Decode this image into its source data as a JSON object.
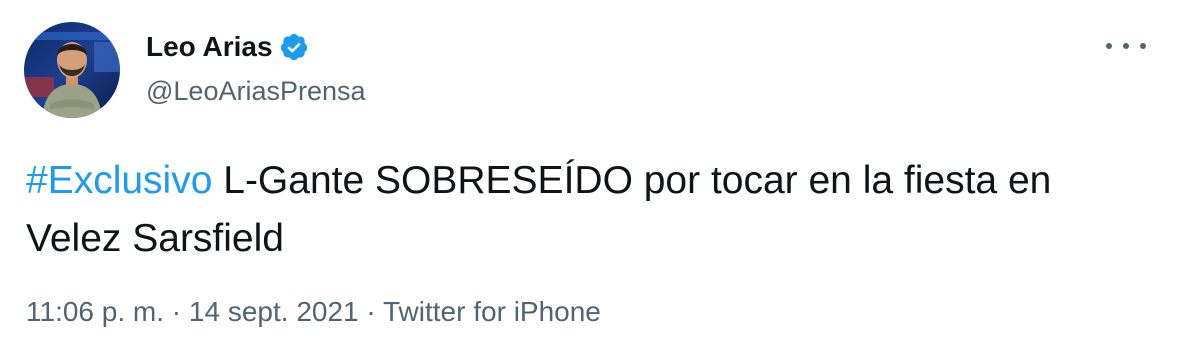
{
  "author": {
    "display_name": "Leo Arias",
    "handle": "@LeoAriasPrensa",
    "verified": true
  },
  "tweet": {
    "hashtag": "#Exclusivo",
    "text": " L-Gante SOBRESEÍDO por tocar en la fiesta en Velez Sarsfield"
  },
  "meta": {
    "time": "11:06 p. m.",
    "separator1": " · ",
    "date": "14 sept. 2021",
    "separator2": " · ",
    "source": "Twitter for iPhone"
  },
  "icons": {
    "verified": "verified-badge-icon",
    "more": "more-options-icon"
  },
  "colors": {
    "accent": "#1d9bf0",
    "text": "#0f1419",
    "secondary": "#536471"
  }
}
